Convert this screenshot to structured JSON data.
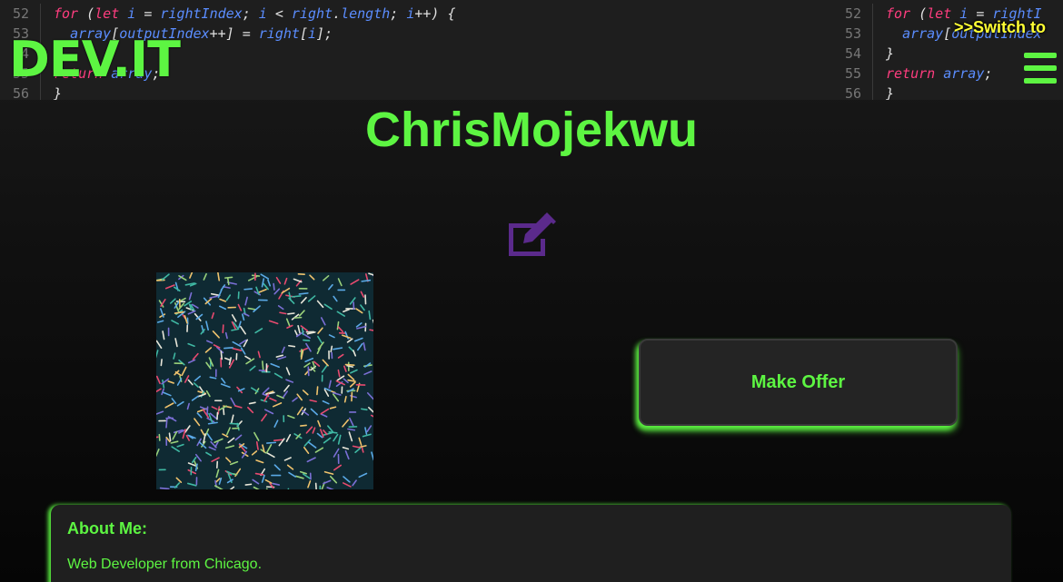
{
  "header": {
    "logo": "DEV.IT",
    "switch_label": ">>Switch to",
    "menu_icon": "hamburger-menu-icon",
    "code_left": [
      {
        "num": "52",
        "tokens": [
          [
            "kw",
            "for "
          ],
          [
            "plain",
            "("
          ],
          [
            "kw",
            "let "
          ],
          [
            "var",
            "i"
          ],
          [
            "plain",
            " = "
          ],
          [
            "var",
            "rightIndex"
          ],
          [
            "plain",
            "; "
          ],
          [
            "var",
            "i"
          ],
          [
            "plain",
            " < "
          ],
          [
            "var",
            "right"
          ],
          [
            "plain",
            "."
          ],
          [
            "fn",
            "length"
          ],
          [
            "plain",
            "; "
          ],
          [
            "var",
            "i"
          ],
          [
            "plain",
            "++) {"
          ]
        ]
      },
      {
        "num": "53",
        "tokens": [
          [
            "plain",
            "  "
          ],
          [
            "var",
            "array"
          ],
          [
            "plain",
            "["
          ],
          [
            "var",
            "outputIndex"
          ],
          [
            "plain",
            "++] = "
          ],
          [
            "var",
            "right"
          ],
          [
            "plain",
            "["
          ],
          [
            "var",
            "i"
          ],
          [
            "plain",
            "];"
          ]
        ]
      },
      {
        "num": "54",
        "tokens": [
          [
            "plain",
            "}"
          ]
        ]
      },
      {
        "num": "55",
        "tokens": [
          [
            "kw",
            "return "
          ],
          [
            "var",
            "array"
          ],
          [
            "plain",
            ";"
          ]
        ]
      },
      {
        "num": "56",
        "tokens": [
          [
            "plain",
            "}"
          ]
        ]
      }
    ],
    "code_right": [
      {
        "num": "52",
        "tokens": [
          [
            "kw",
            "for "
          ],
          [
            "plain",
            "("
          ],
          [
            "kw",
            "let "
          ],
          [
            "var",
            "i"
          ],
          [
            "plain",
            " = "
          ],
          [
            "var",
            "rightI"
          ]
        ]
      },
      {
        "num": "53",
        "tokens": [
          [
            "plain",
            "  "
          ],
          [
            "var",
            "array"
          ],
          [
            "plain",
            "["
          ],
          [
            "var",
            "outputIndex"
          ]
        ]
      },
      {
        "num": "54",
        "tokens": [
          [
            "plain",
            "}"
          ]
        ]
      },
      {
        "num": "55",
        "tokens": [
          [
            "kw",
            "return "
          ],
          [
            "var",
            "array"
          ],
          [
            "plain",
            ";"
          ]
        ]
      },
      {
        "num": "56",
        "tokens": [
          [
            "plain",
            "}"
          ]
        ]
      }
    ]
  },
  "profile": {
    "username": "ChrisMojekwu",
    "edit_icon": "edit-icon",
    "offer_button": "Make Offer"
  },
  "about": {
    "title": "About Me:",
    "text": "Web Developer from Chicago."
  },
  "colors": {
    "accent": "#5df542",
    "switch": "#ffff33",
    "edit_icon": "#5b2a8c"
  }
}
